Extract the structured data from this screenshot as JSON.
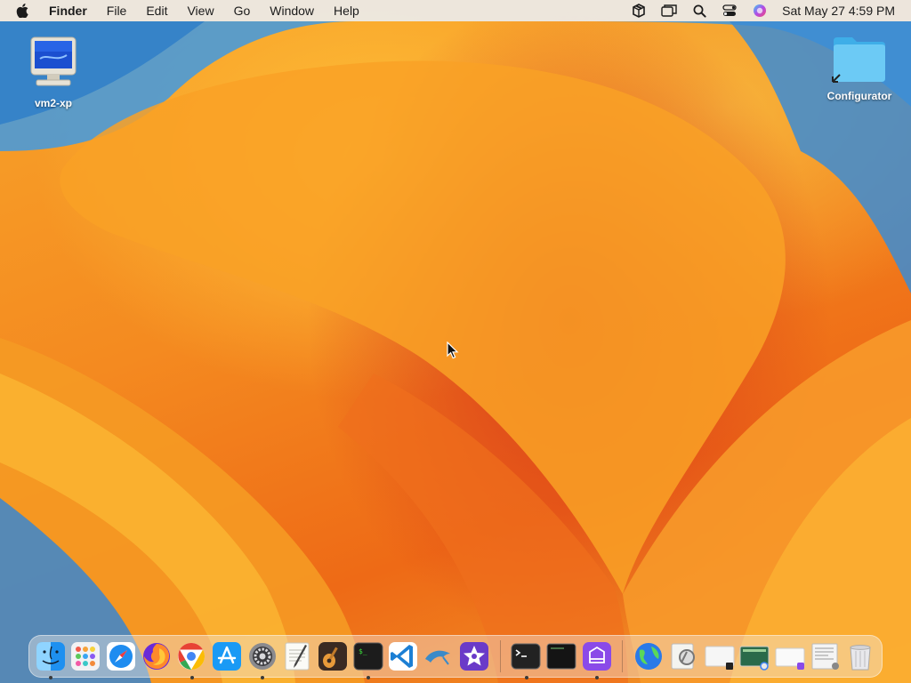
{
  "menubar": {
    "app_name": "Finder",
    "menus": [
      "File",
      "Edit",
      "View",
      "Go",
      "Window",
      "Help"
    ],
    "status_icons": [
      "package-icon",
      "window-stack-icon",
      "spotlight-search-icon",
      "control-center-icon",
      "siri-icon"
    ],
    "clock": "Sat May 27  4:59 PM"
  },
  "desktop_icons": [
    {
      "label": "vm2-xp",
      "icon": "monitor-icon"
    },
    {
      "label": "Configurator",
      "icon": "folder-icon"
    }
  ],
  "dock": {
    "apps": [
      {
        "name": "Finder",
        "icon": "finder-icon",
        "running": true
      },
      {
        "name": "Launchpad",
        "icon": "launchpad-icon",
        "running": false
      },
      {
        "name": "Safari",
        "icon": "safari-icon",
        "running": false
      },
      {
        "name": "Firefox",
        "icon": "firefox-icon",
        "running": false
      },
      {
        "name": "Chrome",
        "icon": "chrome-icon",
        "running": true
      },
      {
        "name": "App Store",
        "icon": "app-store-icon",
        "running": false
      },
      {
        "name": "System Settings",
        "icon": "settings-gear-icon",
        "running": true
      },
      {
        "name": "TextEdit",
        "icon": "textedit-icon",
        "running": false
      },
      {
        "name": "GarageBand",
        "icon": "guitar-icon",
        "running": false
      },
      {
        "name": "Terminal",
        "icon": "terminal-icon",
        "running": true
      },
      {
        "name": "VS Code",
        "icon": "vscode-icon",
        "running": false
      },
      {
        "name": "MySQL Workbench",
        "icon": "dolphin-icon",
        "running": false
      },
      {
        "name": "iMovie",
        "icon": "star-icon",
        "running": false
      }
    ],
    "recents": [
      {
        "name": "Terminal 2",
        "icon": "terminal-prompt-icon",
        "running": true
      },
      {
        "name": "Console",
        "icon": "console-icon",
        "running": false
      },
      {
        "name": "Apple Configurator",
        "icon": "configurator-icon",
        "running": true
      }
    ],
    "stacks": [
      {
        "name": "Network",
        "icon": "globe-icon"
      },
      {
        "name": "Preview",
        "icon": "preview-icon"
      },
      {
        "name": "Window thumbnail 1",
        "icon": "window-thumb-icon"
      },
      {
        "name": "Window thumbnail 2",
        "icon": "window-thumb-icon"
      },
      {
        "name": "Window thumbnail 3",
        "icon": "window-thumb-icon"
      },
      {
        "name": "Window thumbnail 4",
        "icon": "window-thumb-icon"
      },
      {
        "name": "Trash",
        "icon": "trash-icon"
      }
    ]
  },
  "colors": {
    "menubar_bg": "#ececec",
    "wallpaper_orange": "#f48a20",
    "wallpaper_red": "#d8381a",
    "folder_blue": "#5ec4f2"
  }
}
